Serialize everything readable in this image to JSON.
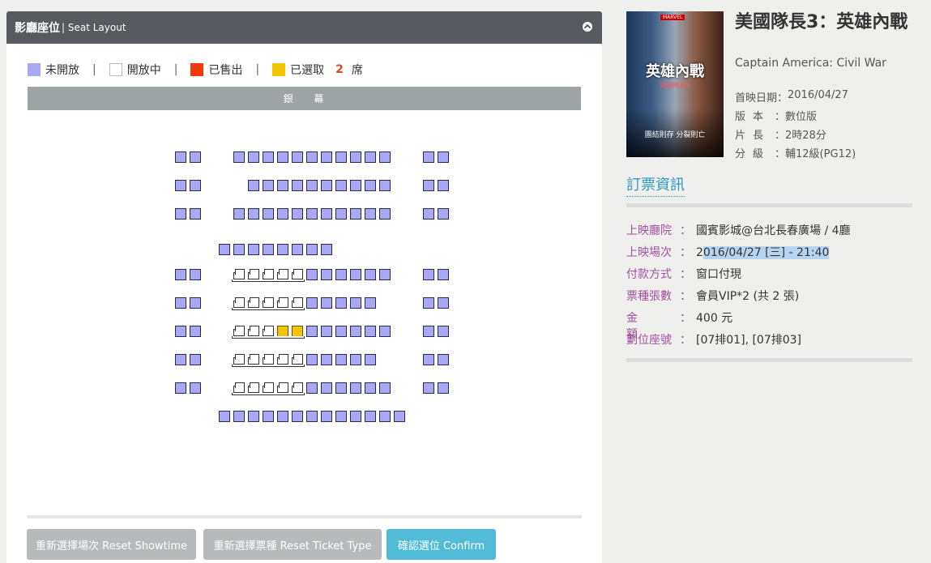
{
  "panel": {
    "title": "影廳座位",
    "subtitle": "| Seat Layout",
    "collapse_icon": "chevron-up-icon"
  },
  "legend": {
    "closed_label": "未開放",
    "open_label": "開放中",
    "sold_label": "已售出",
    "selected_label": "已選取",
    "selected_count": "2",
    "seat_unit": "席",
    "separator": "|",
    "colors": {
      "closed": "#a8a8f5",
      "open": "#ffffff",
      "sold": "#f4390d",
      "selected": "#f6c300"
    }
  },
  "screen": {
    "label": "銀 幕"
  },
  "seat_layout": {
    "states": [
      "closed",
      "open",
      "selected"
    ],
    "rows": [
      {
        "row": 1,
        "seats": "CC·CCCCCCCCCCC·CC"
      },
      {
        "row": 2,
        "seats": "CC·CCCCCCCCCC·CC"
      },
      {
        "row": 3,
        "seats": "CC·CCCCCCCCCCC·CC"
      },
      {
        "row": 4,
        "seats": "CCCCCCCC"
      },
      {
        "row": 5,
        "seats": "CC·OOOOOCCCCCC·CC"
      },
      {
        "row": 6,
        "seats": "CC·OOOOOCCCCC·CC"
      },
      {
        "row": 7,
        "seats": "CC·OOOSSCCCCCC·CC",
        "selected_seats": [
          "07排01",
          "07排03"
        ]
      },
      {
        "row": 8,
        "seats": "CC·OOOOOCCCCC·CC"
      },
      {
        "row": 9,
        "seats": "CC·OOOOOCCCCCC·CC"
      },
      {
        "row": 10,
        "seats": "CCCCCCCCCCCCC"
      }
    ]
  },
  "buttons": {
    "reset_showtime": "重新選擇場次 Reset Showtime",
    "reset_ticket": "重新選擇票種 Reset Ticket Type",
    "confirm": "確認選位 Confirm"
  },
  "movie": {
    "title": "美國隊長3：英雄內戰",
    "title_en": "Captain America: Civil War",
    "poster": {
      "title": "英雄內戰",
      "subtitle": "美國隊長3",
      "tagline": "團結則存 分裂則亡",
      "brand": "MARVEL"
    },
    "details": [
      {
        "key": "首映日期：",
        "value": "2016/04/27"
      },
      {
        "key": "版本",
        "value": "數位版"
      },
      {
        "key": "片長",
        "value": "2時28分"
      },
      {
        "key": "分級",
        "value": "輔12級(PG12)"
      }
    ]
  },
  "booking": {
    "section_title": "訂票資訊",
    "rows": [
      {
        "key": "上映廳院",
        "value": "國賓影城@台北長春廣場 / 4廳"
      },
      {
        "key": "上映場次",
        "value_prefix": "2",
        "value_highlight": "016/04/27 [三] - 21:40"
      },
      {
        "key": "付款方式",
        "value": "窗口付現"
      },
      {
        "key": "票種張數",
        "value": "會員VIP*2 (共 2 張)"
      },
      {
        "key": "金額",
        "value": "400 元"
      },
      {
        "key": "劃位座號",
        "value": "[07排01], [07排03]"
      }
    ]
  }
}
